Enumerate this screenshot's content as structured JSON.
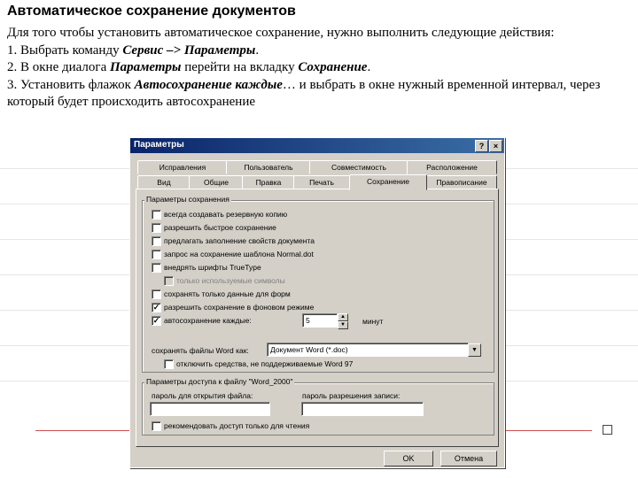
{
  "slide": {
    "title": "Автоматическое сохранение документов",
    "intro": "Для того чтобы установить автоматическое сохранение, нужно выполнить следующие действия:",
    "step1_prefix": "1. Выбрать команду ",
    "step1_bold": "Сервис –> Параметры",
    "step1_suffix": ".",
    "step2_prefix": "2. В окне диалога ",
    "step2_bold1": "Параметры",
    "step2_middle": " перейти на вкладку ",
    "step2_bold2": "Сохранение",
    "step2_suffix": ".",
    "step3_prefix": "3. Установить флажок ",
    "step3_bold": "Автосохранение каждые",
    "step3_suffix": "… и выбрать в окне нужный временной интервал, через который будет происходить автосохранение"
  },
  "dialog": {
    "title": "Параметры",
    "help_button": "?",
    "close_button": "×",
    "tabs_row1": [
      "Исправления",
      "Пользователь",
      "Совместимость",
      "Расположение"
    ],
    "tabs_row2": [
      "Вид",
      "Общие",
      "Правка",
      "Печать",
      "Сохранение",
      "Правописание"
    ],
    "active_tab": "Сохранение",
    "save_group": {
      "label": "Параметры сохранения",
      "options": [
        {
          "label": "всегда создавать резервную копию",
          "checked": false,
          "enabled": true
        },
        {
          "label": "разрешить быстрое сохранение",
          "checked": false,
          "enabled": true
        },
        {
          "label": "предлагать заполнение свойств документа",
          "checked": false,
          "enabled": true
        },
        {
          "label": "запрос на сохранение шаблона Normal.dot",
          "checked": false,
          "enabled": true
        },
        {
          "label": "внедрять шрифты TrueType",
          "checked": false,
          "enabled": true
        },
        {
          "label": "только используемые символы",
          "checked": false,
          "enabled": false
        },
        {
          "label": "сохранять только данные для форм",
          "checked": false,
          "enabled": true
        },
        {
          "label": "разрешить сохранение в фоновом режиме",
          "checked": true,
          "enabled": true
        },
        {
          "label": "автосохранение каждые:",
          "checked": true,
          "enabled": true
        }
      ],
      "autosave_minutes": "5",
      "minutes_label": "минут",
      "save_format_label": "сохранять файлы Word как:",
      "save_format_value": "Документ Word (*.doc)",
      "disable_features_label": "отключить средства, не поддерживаемые Word 97"
    },
    "access_group": {
      "label": "Параметры доступа к файлу \"Word_2000\"",
      "open_password_label": "пароль для открытия файла:",
      "open_password_value": "",
      "write_password_label": "пароль разрешения записи:",
      "write_password_value": "",
      "readonly_label": "рекомендовать доступ только для чтения"
    },
    "ok_label": "OK",
    "cancel_label": "Отмена"
  },
  "colors": {
    "titlebar_start": "#0a246a",
    "titlebar_end": "#3a6ea5",
    "dialog_face": "#d4d0c8",
    "decor_line": "#d05050"
  }
}
